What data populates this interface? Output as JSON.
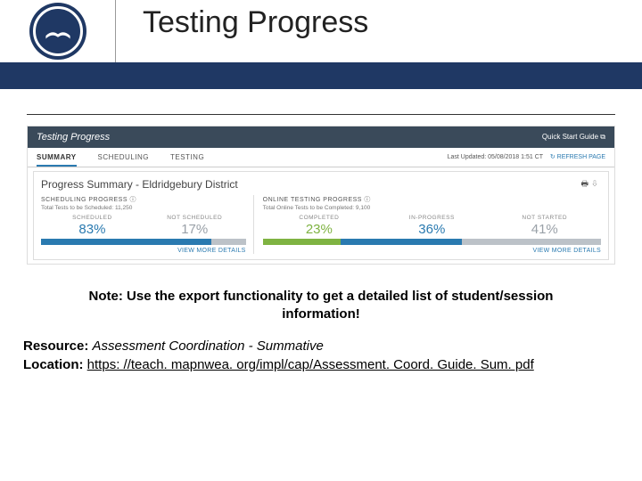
{
  "slide": {
    "title": "Testing Progress"
  },
  "screenshot": {
    "bar_title": "Testing Progress",
    "guide": "Quick Start Guide",
    "tabs": {
      "summary": "SUMMARY",
      "scheduling": "SCHEDULING",
      "testing": "TESTING"
    },
    "updated_prefix": "Last Updated:",
    "updated_value": "05/08/2018 1:51 CT",
    "refresh": "REFRESH PAGE",
    "pane_title": "Progress Summary - Eldridgebury District",
    "scheduling": {
      "title": "SCHEDULING PROGRESS",
      "sub": "Total Tests to be Scheduled: 11,250",
      "scheduled": {
        "label": "SCHEDULED",
        "value": "83%"
      },
      "not_scheduled": {
        "label": "NOT SCHEDULED",
        "value": "17%"
      }
    },
    "online": {
      "title": "ONLINE TESTING PROGRESS",
      "sub": "Total Online Tests to be Completed: 9,100",
      "completed": {
        "label": "COMPLETED",
        "value": "23%"
      },
      "in_progress": {
        "label": "IN-PROGRESS",
        "value": "36%"
      },
      "not_started": {
        "label": "NOT STARTED",
        "value": "41%"
      }
    },
    "details": "VIEW MORE DETAILS"
  },
  "note": "Note: Use the export functionality to get a detailed list of student/session information!",
  "resource": {
    "label": "Resource:",
    "text": "Assessment Coordination - Summative",
    "loc_label": "Location:",
    "url": "https: //teach. mapnwea. org/impl/cap/Assessment. Coord. Guide. Sum. pdf"
  }
}
